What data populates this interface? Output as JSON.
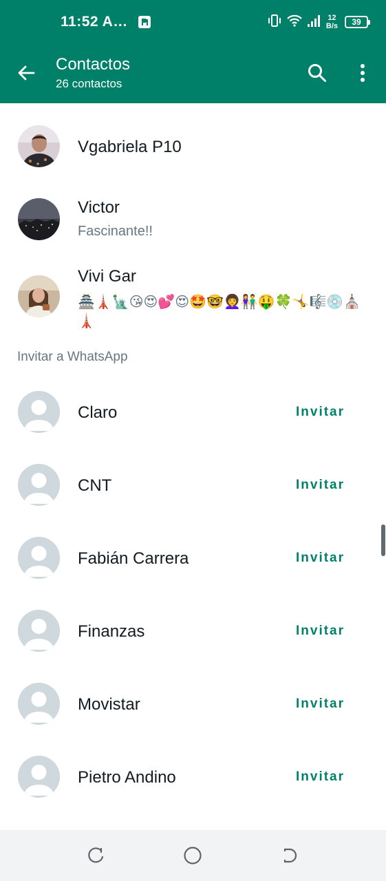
{
  "status_bar": {
    "time": "11:52 A…",
    "net_speed_value": "12",
    "net_speed_unit": "B/s",
    "battery": "39",
    "icons": [
      "notification-icon",
      "vibrate-icon",
      "wifi-icon",
      "signal-icon",
      "battery-icon"
    ]
  },
  "app_bar": {
    "title": "Contactos",
    "subtitle": "26 contactos",
    "color": "#008069"
  },
  "contacts": [
    {
      "name": "Vgabriela P10",
      "status": ""
    },
    {
      "name": "Victor",
      "status": "Fascinante!!"
    },
    {
      "name": "Vivi Gar",
      "status": "🏯🗼🗽😘😍💕😍🤩🤓👩‍🦱👫🤑🍀🤸🎼💿⛪🗼"
    }
  ],
  "invite_section": {
    "header": "Invitar a WhatsApp",
    "invite_label": "Invitar",
    "contacts": [
      {
        "name": "Claro"
      },
      {
        "name": "CNT"
      },
      {
        "name": "Fabián Carrera"
      },
      {
        "name": "Finanzas"
      },
      {
        "name": "Movistar"
      },
      {
        "name": "Pietro Andino"
      }
    ]
  },
  "nav_bar": {
    "icons": [
      "recents-icon",
      "home-icon",
      "back-nav-icon"
    ]
  }
}
